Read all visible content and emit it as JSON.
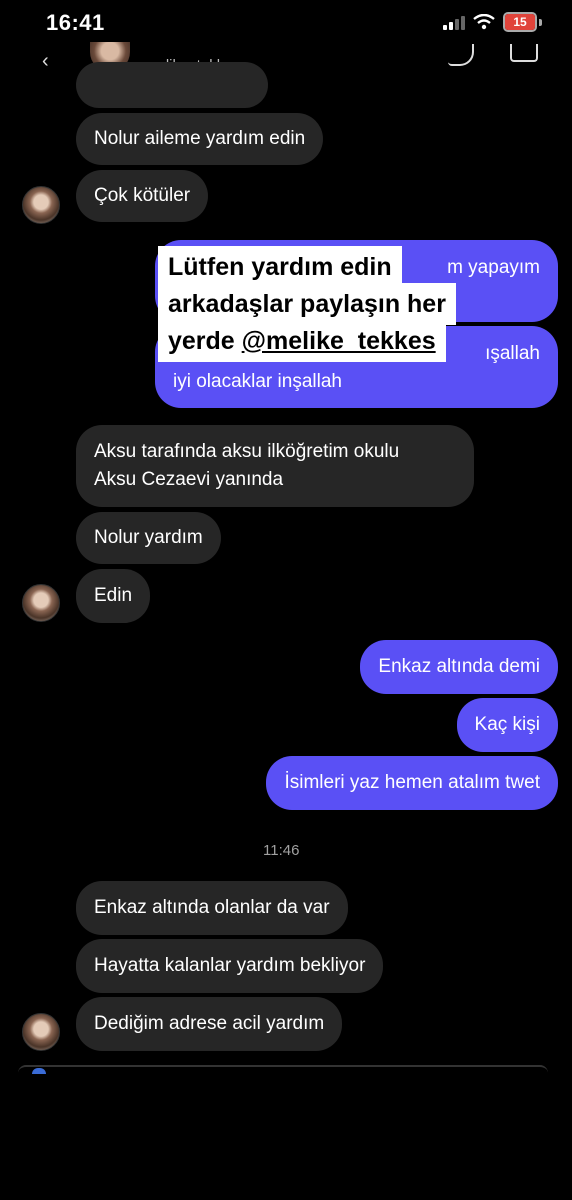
{
  "status_bar": {
    "time": "16:41",
    "battery": "15",
    "battery_color": "#e0433a"
  },
  "header": {
    "username": "melike_tekkes",
    "icons": [
      "back-icon",
      "profile-avatar",
      "phone-icon",
      "video-icon"
    ]
  },
  "overlay": {
    "line1": "Lütfen yardım edin",
    "line2": "arkadaşlar paylaşın her",
    "line3_prefix": "yerde ",
    "line3_mention": "@melike_tekkes"
  },
  "messages": {
    "in1": "Nolur aileme yardım edin",
    "in2": "Çok kötüler",
    "out1_visible": "m yapayım",
    "out2_line1_visible": "ışallah",
    "out2_line2": "iyi olacaklar inşallah",
    "in3_line1": "Aksu tarafında aksu ilköğretim okulu",
    "in3_line2": "Aksu Cezaevi yanında",
    "in4": "Nolur yardım",
    "in5": "Edin",
    "out3": "Enkaz altında demi",
    "out4": "Kaç kişi",
    "out5": "İsimleri yaz hemen atalım twet",
    "timestamp": "11:46",
    "in6": "Enkaz altında olanlar da var",
    "in7": "Hayatta kalanlar yardım bekliyor",
    "in8": "Dediğim adrese acil yardım"
  },
  "colors": {
    "incoming_bubble": "#262626",
    "outgoing_bubble": "#5a50f5",
    "background": "#000000"
  }
}
